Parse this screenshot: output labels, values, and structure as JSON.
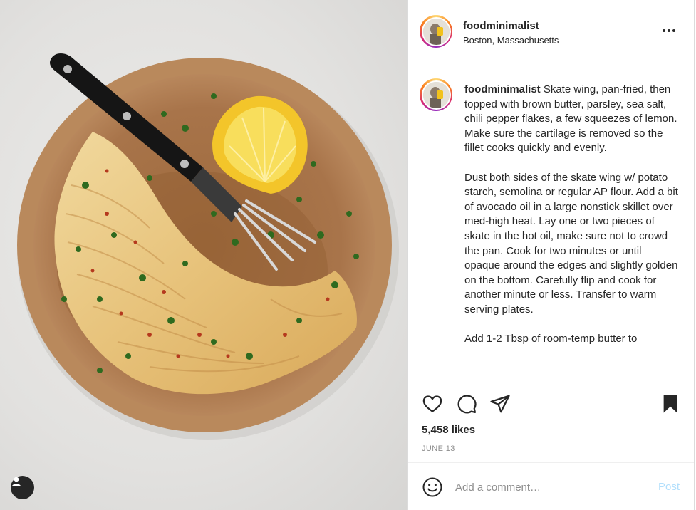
{
  "post": {
    "username": "foodminimalist",
    "location": "Boston, Massachusetts",
    "caption_user": "foodminimalist",
    "caption_paragraphs": [
      " Skate wing, pan-fried, then topped with brown butter, parsley, sea salt, chili pepper flakes, a few squeezes of lemon. Make sure the cartilage is removed so the fillet cooks quickly and evenly.",
      "Dust both sides of the skate wing w/ potato starch, semolina or regular AP flour. Add a bit of avocado oil in a large nonstick skillet over med-high heat. Lay one or two pieces of skate in the hot oil, make sure not to crowd the pan. Cook for two minutes or until opaque around the edges and slightly golden on the bottom. Carefully flip and cook for another minute or less. Transfer to warm serving plates.",
      "Add 1-2 Tbsp of room-temp butter to"
    ],
    "likes": "5,458 likes",
    "date": "JUNE 13"
  },
  "comment": {
    "placeholder": "Add a comment…",
    "post_label": "Post"
  },
  "icons": {
    "more": "more-options-icon",
    "like": "heart-icon",
    "comment": "comment-icon",
    "share": "paper-plane-icon",
    "save": "bookmark-icon",
    "emoji": "emoji-icon",
    "user_tag": "user-tag-icon"
  },
  "colors": {
    "story_ring": [
      "#feda75",
      "#fa7e1e",
      "#d62976",
      "#962fbf"
    ],
    "post_button": "#b2dffc",
    "muted_text": "#8e8e8e"
  }
}
